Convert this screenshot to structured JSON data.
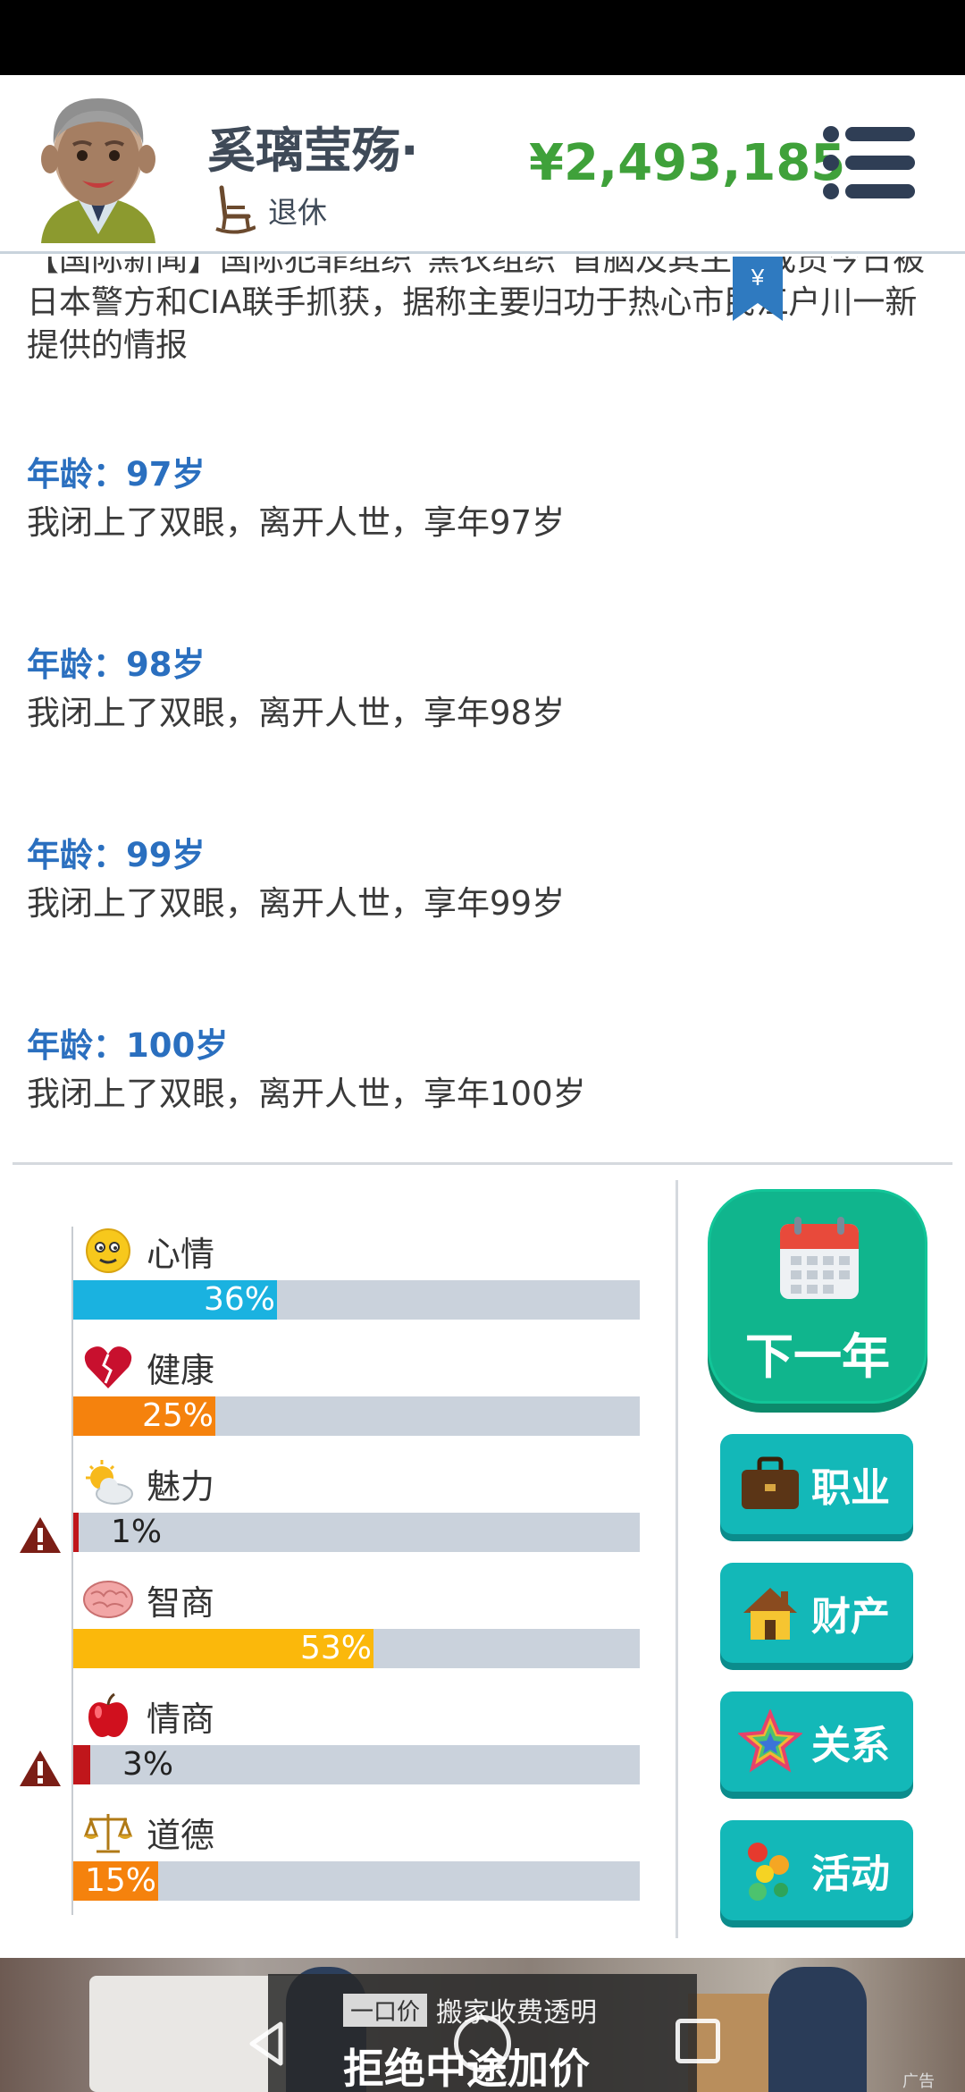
{
  "header": {
    "player_name": "奚璃莹殇·",
    "status": "退休",
    "money": "¥2,493,185"
  },
  "log": {
    "news_partial": "【国际新闻】国际犯罪组织\"黑衣组织\"首脑及其主要成员今日被日本警方和CIA联手抓获，据称主要归功于热心市民江户川一新提供的情报",
    "entries": [
      {
        "age": "年龄：97岁",
        "message": "我闭上了双眼，离开人世，享年97岁"
      },
      {
        "age": "年龄：98岁",
        "message": "我闭上了双眼，离开人世，享年98岁"
      },
      {
        "age": "年龄：99岁",
        "message": "我闭上了双眼，离开人世，享年99岁"
      },
      {
        "age": "年龄：100岁",
        "message": "我闭上了双眼，离开人世，享年100岁"
      }
    ]
  },
  "stats": [
    {
      "label": "心情",
      "value": 36,
      "display": "36%",
      "color": "#1ab2e0",
      "icon": "smiley-icon",
      "warning": false
    },
    {
      "label": "健康",
      "value": 25,
      "display": "25%",
      "color": "#f5820d",
      "icon": "broken-heart-icon",
      "warning": false
    },
    {
      "label": "魅力",
      "value": 1,
      "display": "1%",
      "color": "#c0161b",
      "icon": "sun-cloud-icon",
      "warning": true
    },
    {
      "label": "智商",
      "value": 53,
      "display": "53%",
      "color": "#fbb80b",
      "icon": "brain-icon",
      "warning": false
    },
    {
      "label": "情商",
      "value": 3,
      "display": "3%",
      "color": "#c0161b",
      "icon": "apple-icon",
      "warning": true
    },
    {
      "label": "道德",
      "value": 15,
      "display": "15%",
      "color": "#f5820d",
      "icon": "scales-icon",
      "warning": false
    }
  ],
  "actions": {
    "next_year": "下一年",
    "buttons": [
      {
        "label": "职业",
        "icon": "briefcase-icon"
      },
      {
        "label": "财产",
        "icon": "house-icon"
      },
      {
        "label": "关系",
        "icon": "star-icon"
      },
      {
        "label": "活动",
        "icon": "dots-icon"
      }
    ]
  },
  "ad": {
    "tag_box": "一口价",
    "tag_text": "搬家收费透明",
    "slogan": "拒绝中途加价",
    "mark": "广告"
  }
}
